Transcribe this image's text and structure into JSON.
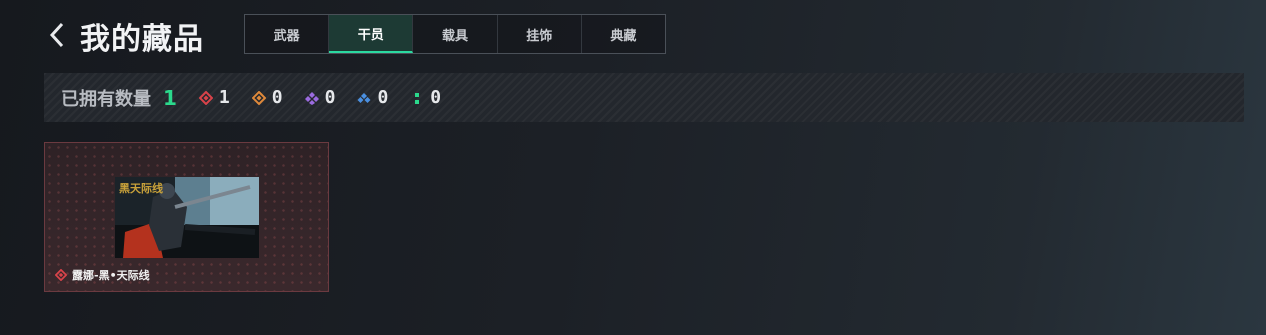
{
  "header": {
    "title": "我的藏品"
  },
  "tabs": [
    {
      "label": "武器",
      "active": false
    },
    {
      "label": "干员",
      "active": true
    },
    {
      "label": "载具",
      "active": false
    },
    {
      "label": "挂饰",
      "active": false
    },
    {
      "label": "典藏",
      "active": false
    }
  ],
  "stats": {
    "owned_label": "已拥有数量",
    "owned_count": "1",
    "rarities": [
      {
        "icon": "red-diamond-icon",
        "color": "#d9434a",
        "count": "1"
      },
      {
        "icon": "orange-diamond-icon",
        "color": "#e0893a",
        "count": "0"
      },
      {
        "icon": "purple-cluster-icon",
        "color": "#9b6be0",
        "count": "0"
      },
      {
        "icon": "blue-cluster-icon",
        "color": "#4a8fe0",
        "count": "0"
      },
      {
        "icon": "green-dots-icon",
        "color": "#2bd98c",
        "count": "0"
      }
    ]
  },
  "collection": {
    "items": [
      {
        "name": "露娜-黑•天际线",
        "rarity_color": "#d9434a",
        "image_title": "黑天际线"
      }
    ]
  },
  "colors": {
    "accent": "#2bd9a0",
    "owned_count": "#2bd98c",
    "card_border": "#6b3a40"
  }
}
